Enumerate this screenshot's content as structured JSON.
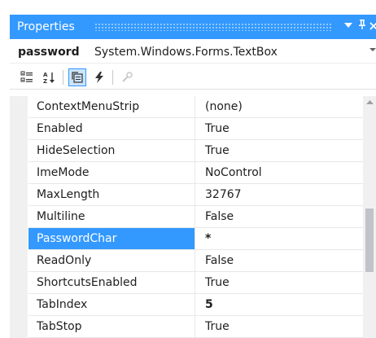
{
  "window": {
    "title": "Properties",
    "dropdown_glyph": "▼",
    "pin_glyph": "ᵖ",
    "close_glyph": "✕"
  },
  "object_selector": {
    "name": "password",
    "type": "System.Windows.Forms.TextBox"
  },
  "toolbar": {
    "buttons": [
      {
        "icon": "categorized-icon",
        "active": false
      },
      {
        "icon": "alphabetical-sort-icon",
        "active": false
      },
      {
        "icon": "properties-icon",
        "active": true
      },
      {
        "icon": "events-lightning-icon",
        "active": false
      },
      {
        "icon": "property-pages-icon",
        "active": false,
        "disabled": true
      }
    ]
  },
  "grid": {
    "rows": [
      {
        "name": "ContextMenuStrip",
        "value": "(none)"
      },
      {
        "name": "Enabled",
        "value": "True"
      },
      {
        "name": "HideSelection",
        "value": "True"
      },
      {
        "name": "ImeMode",
        "value": "NoControl"
      },
      {
        "name": "MaxLength",
        "value": "32767"
      },
      {
        "name": "Multiline",
        "value": "False"
      },
      {
        "name": "PasswordChar",
        "value": "*",
        "selected": true,
        "bold": true
      },
      {
        "name": "ReadOnly",
        "value": "False"
      },
      {
        "name": "ShortcutsEnabled",
        "value": "True"
      },
      {
        "name": "TabIndex",
        "value": "5",
        "bold": true
      },
      {
        "name": "TabStop",
        "value": "True"
      }
    ]
  },
  "colors": {
    "accent": "#3399ff",
    "selected_text": "#ffffff",
    "text": "#1e1e1e",
    "margin": "#f0f0f0",
    "gridline": "#e8e8e8"
  }
}
